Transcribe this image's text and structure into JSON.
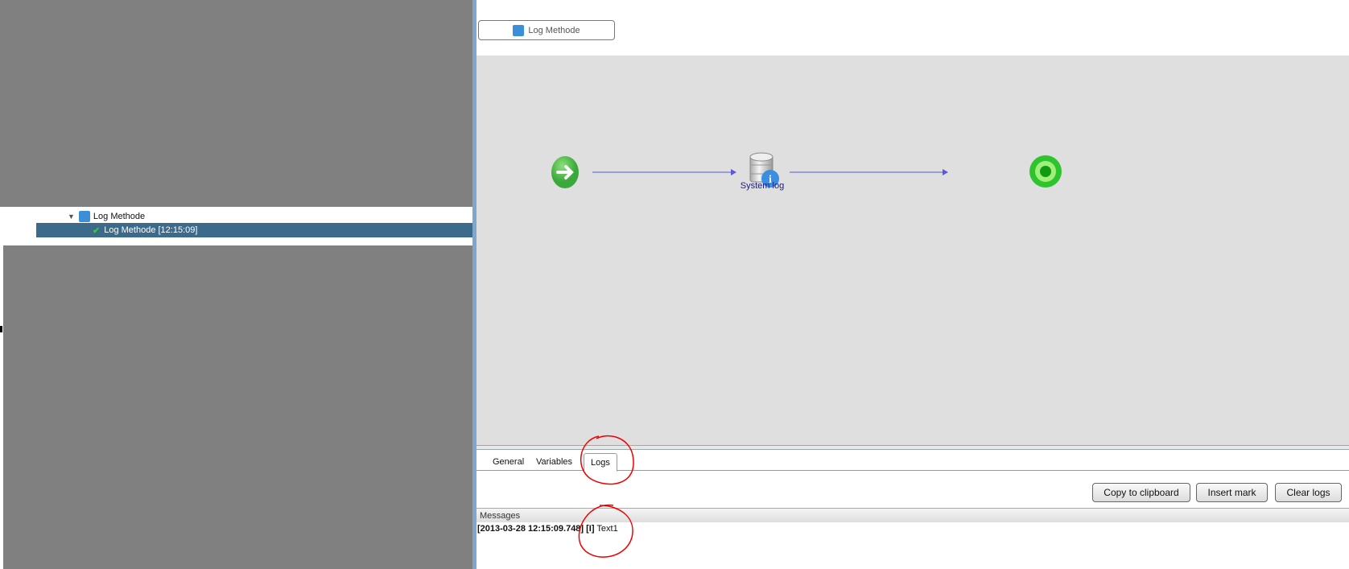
{
  "tree": {
    "parent_label": "Log Methode",
    "selected_label": "Log Methode [12:15:09]"
  },
  "process_button": {
    "label": "Log Methode"
  },
  "diagram": {
    "node_label": "System log",
    "colors": {
      "edge": "#5a5ad8",
      "start": "#4cbb3c",
      "end": "#22cc22"
    }
  },
  "tabs": [
    {
      "label": "General"
    },
    {
      "label": "Variables"
    },
    {
      "label": "Logs"
    }
  ],
  "buttons": {
    "copy": "Copy to clipboard",
    "mark": "Insert mark",
    "clear": "Clear logs"
  },
  "messages": {
    "header": "Messages",
    "entries": [
      {
        "prefix": "[2013-03-28 12:15:09.748] [I]",
        "text": "Text1"
      }
    ]
  }
}
